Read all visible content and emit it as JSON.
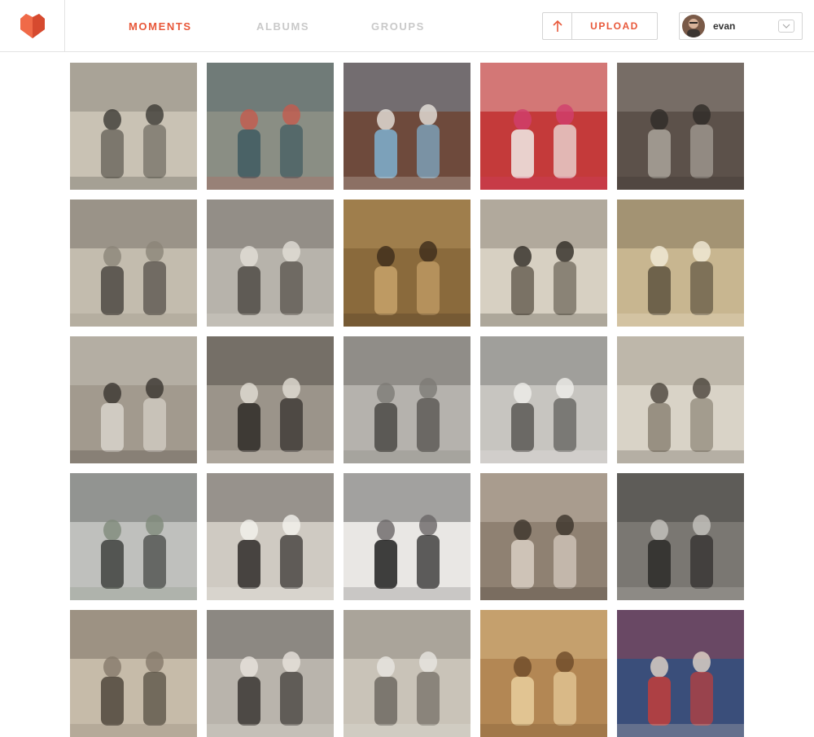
{
  "nav": {
    "moments": "MOMENTS",
    "albums": "ALBUMS",
    "groups": "GROUPS"
  },
  "upload": {
    "label": "UPLOAD"
  },
  "user": {
    "name": "evan"
  },
  "colors": {
    "accent": "#e8583a",
    "nav_inactive": "#c9c9c9"
  },
  "icons": {
    "logo": "heart-logo-icon",
    "upload": "arrow-up-icon",
    "dropdown": "chevron-down-icon"
  },
  "photos": [
    {
      "bg": "#c9c2b4",
      "tint": "#6e6a60",
      "accent": "#3c3a35"
    },
    {
      "bg": "#8a8e84",
      "tint": "#3e5a60",
      "accent": "#c45b4e"
    },
    {
      "bg": "#6e4a3c",
      "tint": "#7fb0d0",
      "accent": "#e7e2dc"
    },
    {
      "bg": "#c43a3a",
      "tint": "#f0ece8",
      "accent": "#d13f6e"
    },
    {
      "bg": "#5c514a",
      "tint": "#a9a39a",
      "accent": "#2e2a27"
    },
    {
      "bg": "#c3bcae",
      "tint": "#4e4943",
      "accent": "#8b8478"
    },
    {
      "bg": "#b7b3ab",
      "tint": "#504b45",
      "accent": "#e2ded7"
    },
    {
      "bg": "#8a6a3c",
      "tint": "#c7a26a",
      "accent": "#3c2c1a"
    },
    {
      "bg": "#d7d0c2",
      "tint": "#6a6255",
      "accent": "#2f2a24"
    },
    {
      "bg": "#c8b690",
      "tint": "#5e5440",
      "accent": "#f3ecd8"
    },
    {
      "bg": "#a29a8e",
      "tint": "#d8d3cb",
      "accent": "#3a352f"
    },
    {
      "bg": "#9b948a",
      "tint": "#2e2a26",
      "accent": "#e2ddd5"
    },
    {
      "bg": "#b5b2ad",
      "tint": "#4b4945",
      "accent": "#7d7a75"
    },
    {
      "bg": "#c7c5c0",
      "tint": "#5a5855",
      "accent": "#efedea"
    },
    {
      "bg": "#d9d3c7",
      "tint": "#8c8476",
      "accent": "#4a443b"
    },
    {
      "bg": "#bfc0bd",
      "tint": "#3f423f",
      "accent": "#7f8a7a"
    },
    {
      "bg": "#cfcac2",
      "tint": "#2f2c29",
      "accent": "#f4f2ee"
    },
    {
      "bg": "#e9e7e4",
      "tint": "#202020",
      "accent": "#6a6766"
    },
    {
      "bg": "#8f8172",
      "tint": "#d9cfc3",
      "accent": "#3b332b"
    },
    {
      "bg": "#7a7772",
      "tint": "#2c2a28",
      "accent": "#c7c4bf"
    },
    {
      "bg": "#c6bba9",
      "tint": "#4f473c",
      "accent": "#85796a"
    },
    {
      "bg": "#b9b4ac",
      "tint": "#3a3633",
      "accent": "#e8e4dd"
    },
    {
      "bg": "#c9c3b8",
      "tint": "#6f6a61",
      "accent": "#e9e6e1"
    },
    {
      "bg": "#b38754",
      "tint": "#e9cf9d",
      "accent": "#6d4a28"
    },
    {
      "bg": "#3a4e7a",
      "tint": "#c23e3b",
      "accent": "#e4d7c9"
    }
  ]
}
